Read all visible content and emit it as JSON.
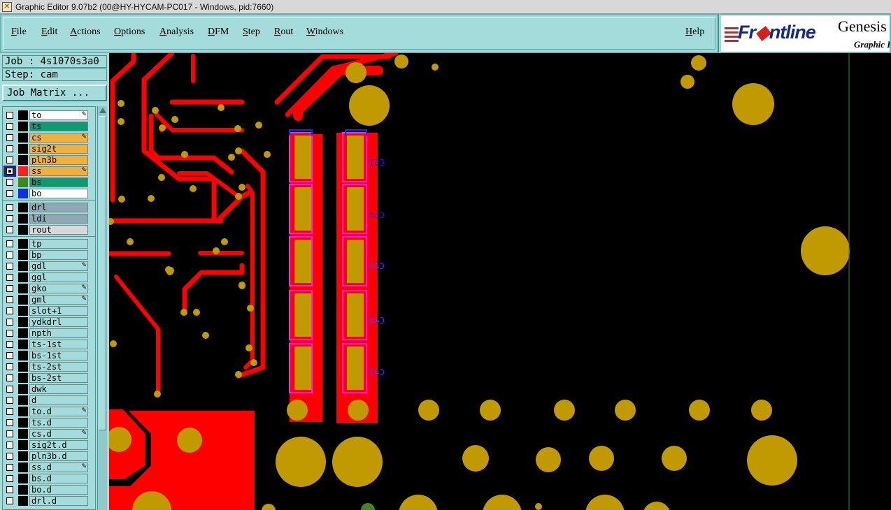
{
  "window": {
    "title": "Graphic Editor 9.07b2 (00@HY-HYCAM-PC017 - Windows, pid:7660)",
    "icon": "x-window-icon"
  },
  "menu": {
    "items": [
      {
        "label": "File",
        "key": "F",
        "rest": "ile"
      },
      {
        "label": "Edit",
        "key": "E",
        "rest": "dit"
      },
      {
        "label": "Actions",
        "key": "A",
        "rest": "ctions"
      },
      {
        "label": "Options",
        "key": "O",
        "rest": "ptions"
      },
      {
        "label": "Analysis",
        "key": "A",
        "rest": "nalysis"
      },
      {
        "label": "DFM",
        "key": "D",
        "rest": "FM"
      },
      {
        "label": "Step",
        "key": "S",
        "rest": "tep"
      },
      {
        "label": "Rout",
        "key": "R",
        "rest": "out"
      },
      {
        "label": "Windows",
        "key": "W",
        "rest": "indows"
      }
    ],
    "help": {
      "label": "Help",
      "key": "H",
      "rest": "elp"
    }
  },
  "logo": {
    "brand_pre": "Fr",
    "brand_dot": "◆",
    "brand_post": "ntline",
    "product": "Genesis",
    "subtitle": "Graphic I"
  },
  "job": {
    "job_label": "Job : 4s1070s3a0",
    "step_label": "Step: cam",
    "matrix_button": "Job Matrix ..."
  },
  "layers": [
    {
      "name": "to",
      "color": "#ffffff",
      "swatch": "#000000",
      "checked": false,
      "edit": true
    },
    {
      "name": "ts",
      "color": "#0f9a74",
      "swatch": "#000000",
      "checked": false,
      "edit": false
    },
    {
      "name": "cs",
      "color": "#f0b040",
      "swatch": "#000000",
      "checked": false,
      "edit": true
    },
    {
      "name": "sig2t",
      "color": "#f0b040",
      "swatch": "#000000",
      "checked": false,
      "edit": false
    },
    {
      "name": "pln3b",
      "color": "#f0b040",
      "swatch": "#000000",
      "checked": false,
      "edit": false
    },
    {
      "name": "ss",
      "color": "#f0b040",
      "swatch": "#ff2020",
      "checked": true,
      "edit": true,
      "selected": true
    },
    {
      "name": "bs",
      "color": "#0f9a74",
      "swatch": "#3a8a1a",
      "checked": false,
      "edit": false
    },
    {
      "name": "bo",
      "color": "#ffffff",
      "swatch": "#1030e0",
      "checked": false,
      "edit": false
    },
    {
      "name": "drl",
      "color": "#8fa8b4",
      "swatch": "#000000",
      "checked": false,
      "edit": false
    },
    {
      "name": "ldi",
      "color": "#8fa8b4",
      "swatch": "#000000",
      "checked": false,
      "edit": false
    },
    {
      "name": "rout",
      "color": "#d8d8d8",
      "swatch": "#000000",
      "checked": false,
      "edit": false
    },
    {
      "name": "tp",
      "color": "#a4dcdc",
      "swatch": "#000000",
      "checked": false,
      "edit": false
    },
    {
      "name": "bp",
      "color": "#a4dcdc",
      "swatch": "#000000",
      "checked": false,
      "edit": false
    },
    {
      "name": "gdl",
      "color": "#a4dcdc",
      "swatch": "#000000",
      "checked": false,
      "edit": true
    },
    {
      "name": "ggl",
      "color": "#a4dcdc",
      "swatch": "#000000",
      "checked": false,
      "edit": false
    },
    {
      "name": "gko",
      "color": "#a4dcdc",
      "swatch": "#000000",
      "checked": false,
      "edit": true
    },
    {
      "name": "gml",
      "color": "#a4dcdc",
      "swatch": "#000000",
      "checked": false,
      "edit": true
    },
    {
      "name": "slot+1",
      "color": "#a4dcdc",
      "swatch": "#000000",
      "checked": false,
      "edit": false
    },
    {
      "name": "ydkdrl",
      "color": "#a4dcdc",
      "swatch": "#000000",
      "checked": false,
      "edit": false
    },
    {
      "name": "npth",
      "color": "#a4dcdc",
      "swatch": "#000000",
      "checked": false,
      "edit": false
    },
    {
      "name": "ts-1st",
      "color": "#a4dcdc",
      "swatch": "#000000",
      "checked": false,
      "edit": false
    },
    {
      "name": "bs-1st",
      "color": "#a4dcdc",
      "swatch": "#000000",
      "checked": false,
      "edit": false
    },
    {
      "name": "ts-2st",
      "color": "#a4dcdc",
      "swatch": "#000000",
      "checked": false,
      "edit": false
    },
    {
      "name": "bs-2st",
      "color": "#a4dcdc",
      "swatch": "#000000",
      "checked": false,
      "edit": false
    },
    {
      "name": "dwk",
      "color": "#a4dcdc",
      "swatch": "#000000",
      "checked": false,
      "edit": false
    },
    {
      "name": "d",
      "color": "#a4dcdc",
      "swatch": "#000000",
      "checked": false,
      "edit": false
    },
    {
      "name": "to.d",
      "color": "#a4dcdc",
      "swatch": "#000000",
      "checked": false,
      "edit": true
    },
    {
      "name": "ts.d",
      "color": "#a4dcdc",
      "swatch": "#000000",
      "checked": false,
      "edit": false
    },
    {
      "name": "cs.d",
      "color": "#a4dcdc",
      "swatch": "#000000",
      "checked": false,
      "edit": true
    },
    {
      "name": "sig2t.d",
      "color": "#a4dcdc",
      "swatch": "#000000",
      "checked": false,
      "edit": false
    },
    {
      "name": "pln3b.d",
      "color": "#a4dcdc",
      "swatch": "#000000",
      "checked": false,
      "edit": false
    },
    {
      "name": "ss.d",
      "color": "#a4dcdc",
      "swatch": "#000000",
      "checked": false,
      "edit": true
    },
    {
      "name": "bs.d",
      "color": "#a4dcdc",
      "swatch": "#000000",
      "checked": false,
      "edit": false
    },
    {
      "name": "bo.d",
      "color": "#a4dcdc",
      "swatch": "#000000",
      "checked": false,
      "edit": false
    },
    {
      "name": "drl.d",
      "color": "#a4dcdc",
      "swatch": "#000000",
      "checked": false,
      "edit": false
    }
  ],
  "canvas": {
    "colors": {
      "trace": "#ff0000",
      "pad": "#c09a00",
      "outline": "#ff20ff",
      "text": "#2020ff",
      "edge": "#3a8a1a"
    },
    "refdes": [
      "C51",
      "C50",
      "C49",
      "C48",
      "C47"
    ]
  }
}
